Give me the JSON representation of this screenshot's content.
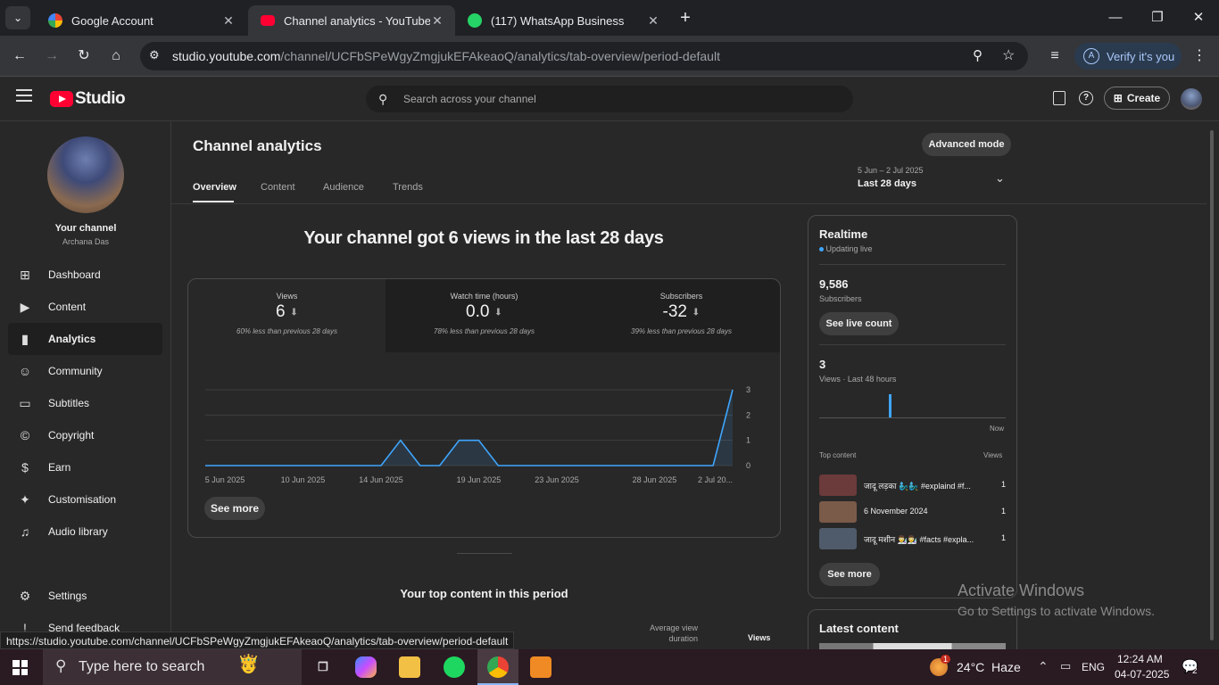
{
  "browser": {
    "tabs": [
      {
        "title": "Google Account",
        "favicon": "google-icon"
      },
      {
        "title": "Channel analytics - YouTube Stu",
        "favicon": "youtube-icon"
      },
      {
        "title": "(117) WhatsApp Business",
        "favicon": "whatsapp-icon"
      }
    ],
    "url_host": "studio.youtube.com",
    "url_path": "/channel/UCFbSPeWgyZmgjukEFAkeaoQ/analytics/tab-overview/period-default",
    "verify_label": "Verify it's you",
    "verify_avatar": "A"
  },
  "header": {
    "logo_text": "Studio",
    "search_placeholder": "Search across your channel",
    "create_label": "Create"
  },
  "sidebar": {
    "channel_title": "Your channel",
    "channel_name": "Archana Das",
    "items": [
      {
        "label": "Dashboard",
        "icon": "dashboard-icon"
      },
      {
        "label": "Content",
        "icon": "content-icon"
      },
      {
        "label": "Analytics",
        "icon": "analytics-icon"
      },
      {
        "label": "Community",
        "icon": "community-icon"
      },
      {
        "label": "Subtitles",
        "icon": "subtitles-icon"
      },
      {
        "label": "Copyright",
        "icon": "copyright-icon"
      },
      {
        "label": "Earn",
        "icon": "earn-icon"
      },
      {
        "label": "Customisation",
        "icon": "customisation-icon"
      },
      {
        "label": "Audio library",
        "icon": "audio-library-icon"
      }
    ],
    "settings_label": "Settings",
    "feedback_label": "Send feedback"
  },
  "analytics": {
    "title": "Channel analytics",
    "advanced_label": "Advanced mode",
    "tabs": [
      "Overview",
      "Content",
      "Audience",
      "Trends"
    ],
    "date_range": "5 Jun – 2 Jul 2025",
    "period_label": "Last 28 days",
    "headline": "Your channel got 6 views in the last 28 days",
    "metrics": [
      {
        "label": "Views",
        "value": "6",
        "note": "60% less than previous 28 days"
      },
      {
        "label": "Watch time (hours)",
        "value": "0.0",
        "note": "78% less than previous 28 days"
      },
      {
        "label": "Subscribers",
        "value": "-32",
        "note": "39% less than previous 28 days"
      }
    ],
    "see_more_label": "See more",
    "top_content_title": "Your top content in this period",
    "col_avg_view": "Average view",
    "col_avg_view2": "duration",
    "col_views": "Views"
  },
  "chart_data": {
    "type": "line",
    "x_tick_labels": [
      "5 Jun 2025",
      "10 Jun 2025",
      "14 Jun 2025",
      "19 Jun 2025",
      "23 Jun 2025",
      "28 Jun 2025",
      "2 Jul 20..."
    ],
    "x": [
      "5 Jun",
      "6 Jun",
      "7 Jun",
      "8 Jun",
      "9 Jun",
      "10 Jun",
      "11 Jun",
      "12 Jun",
      "13 Jun",
      "14 Jun",
      "15 Jun",
      "16 Jun",
      "17 Jun",
      "18 Jun",
      "19 Jun",
      "20 Jun",
      "21 Jun",
      "22 Jun",
      "23 Jun",
      "24 Jun",
      "25 Jun",
      "26 Jun",
      "27 Jun",
      "28 Jun",
      "29 Jun",
      "30 Jun",
      "1 Jul",
      "2 Jul"
    ],
    "values": [
      0,
      0,
      0,
      0,
      0,
      0,
      0,
      0,
      0,
      0,
      1,
      0,
      0,
      1,
      1,
      0,
      0,
      0,
      0,
      0,
      0,
      0,
      0,
      0,
      0,
      0,
      0,
      3
    ],
    "y_ticks": [
      "0",
      "1",
      "2",
      "3"
    ],
    "ylim": [
      0,
      3
    ],
    "color": "#3ea6ff"
  },
  "realtime": {
    "title": "Realtime",
    "updating": "Updating live",
    "subs_value": "9,586",
    "subs_label": "Subscribers",
    "live_count_label": "See live count",
    "views_value": "3",
    "views_label": "Views · Last 48 hours",
    "now_label": "Now",
    "top_content_label": "Top content",
    "views_col": "Views",
    "items": [
      {
        "title": "जादू लड़का 🧞‍♂️🧞‍♂️ #explaind #f...",
        "views": "1",
        "thumb": "#6b3a3a"
      },
      {
        "title": "6 November 2024",
        "views": "1",
        "thumb": "#7a5a48"
      },
      {
        "title": "जादू मशीन 👨‍🔬👨‍🔬 #facts #expla...",
        "views": "1",
        "thumb": "#4f5a6a"
      }
    ],
    "see_more_label": "See more",
    "latest_title": "Latest content"
  },
  "watermark": {
    "line1": "Activate Windows",
    "line2": "Go to Settings to activate Windows."
  },
  "statusbar": "https://studio.youtube.com/channel/UCFbSPeWgyZmgjukEFAkeaoQ/analytics/tab-overview/period-default",
  "taskbar": {
    "search_placeholder": "Type here to search",
    "weather": "24°C  Haze",
    "language": "ENG",
    "time": "12:24 AM",
    "date": "04-07-2025",
    "notification_count": "2",
    "weather_badge": "1"
  }
}
